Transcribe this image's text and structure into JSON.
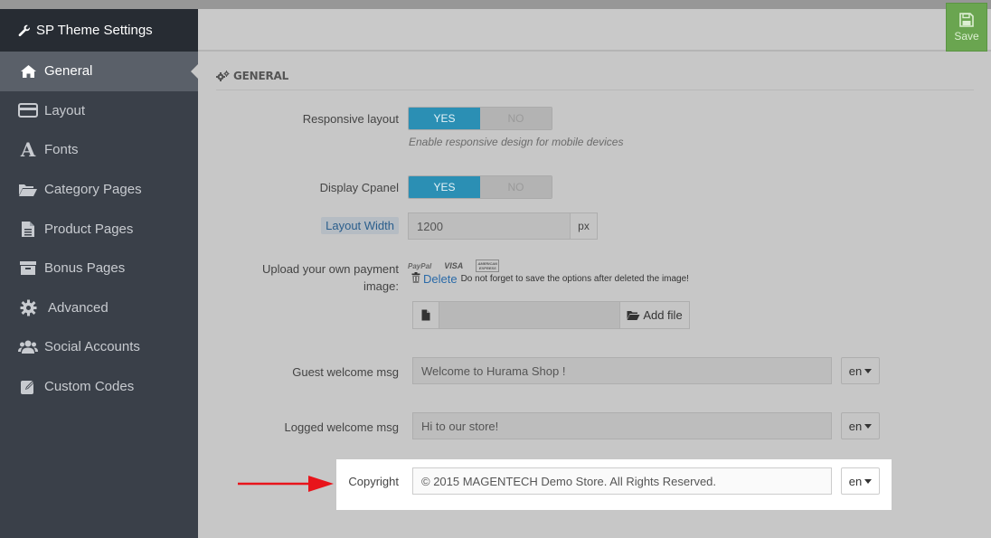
{
  "sidebar": {
    "title": "SP Theme Settings",
    "items": [
      {
        "label": "General",
        "icon": "home-icon",
        "active": true
      },
      {
        "label": "Layout",
        "icon": "credit-card-icon"
      },
      {
        "label": "Fonts",
        "icon": "font-icon"
      },
      {
        "label": "Category Pages",
        "icon": "folder-open-icon"
      },
      {
        "label": "Product Pages",
        "icon": "file-icon"
      },
      {
        "label": "Bonus Pages",
        "icon": "archive-icon"
      },
      {
        "label": "Advanced",
        "icon": "gear-icon"
      },
      {
        "label": "Social Accounts",
        "icon": "users-icon"
      },
      {
        "label": "Custom Codes",
        "icon": "edit-icon"
      }
    ]
  },
  "toolbar": {
    "save_label": "Save"
  },
  "section": {
    "title": "GENERAL"
  },
  "form": {
    "responsive": {
      "label": "Responsive layout",
      "yes": "YES",
      "no": "NO",
      "help": "Enable responsive design for mobile devices"
    },
    "cpanel": {
      "label": "Display Cpanel",
      "yes": "YES",
      "no": "NO"
    },
    "layout_width": {
      "label": "Layout Width",
      "value": "1200",
      "unit": "px"
    },
    "payment": {
      "label_line1": "Upload your own payment",
      "label_line2": "image:",
      "cards": [
        "PayPal",
        "VISA",
        "AMERICAN EXPRESS"
      ],
      "delete_label": "Delete",
      "delete_note": "Do not forget to save the options after deleted the image!",
      "add_file_label": "Add file"
    },
    "guest": {
      "label": "Guest welcome msg",
      "value": "Welcome to Hurama Shop !",
      "lang": "en"
    },
    "logged": {
      "label": "Logged welcome msg",
      "value": "Hi to our store!",
      "lang": "en"
    },
    "copyright": {
      "label": "Copyright",
      "value": "© 2015 MAGENTECH Demo Store. All Rights Reserved.",
      "lang": "en"
    }
  },
  "colors": {
    "sidebar_bg": "#3a4049",
    "accent": "#2b8fb4",
    "save": "#6aa550",
    "arrow": "#e8141b"
  }
}
